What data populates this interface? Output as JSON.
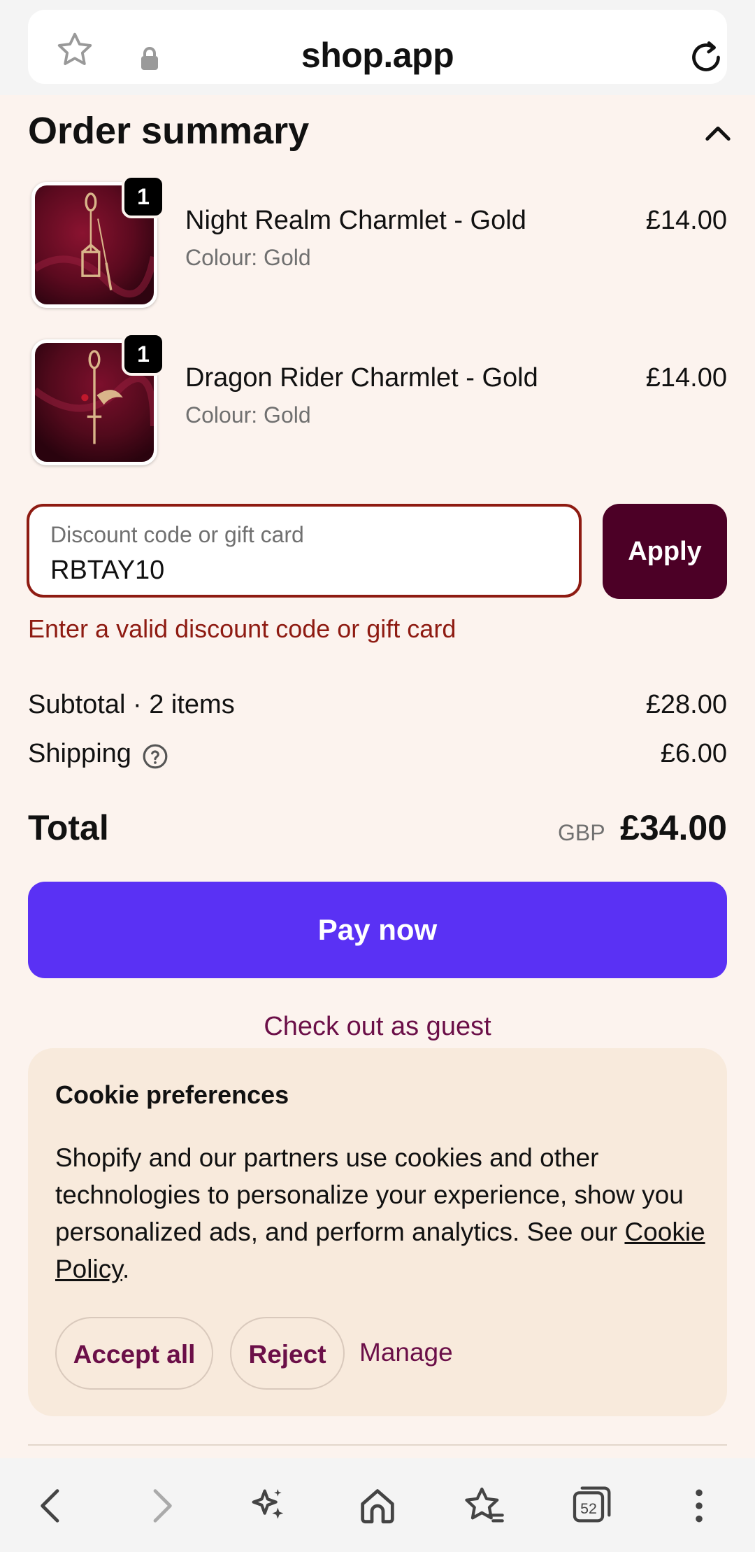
{
  "browser": {
    "domain": "shop.app",
    "tab_count": "52"
  },
  "order_summary": {
    "title": "Order summary",
    "items": [
      {
        "name": "Night Realm Charmlet - Gold",
        "variant": "Colour: Gold",
        "price": "£14.00",
        "quantity": "1"
      },
      {
        "name": "Dragon Rider Charmlet - Gold",
        "variant": "Colour: Gold",
        "price": "£14.00",
        "quantity": "1"
      }
    ]
  },
  "discount": {
    "label": "Discount code or gift card",
    "value": "RBTAY10",
    "apply_label": "Apply",
    "error": "Enter a valid discount code or gift card"
  },
  "totals": {
    "subtotal_label": "Subtotal · 2 items",
    "subtotal_value": "£28.00",
    "shipping_label": "Shipping",
    "shipping_value": "£6.00",
    "total_label": "Total",
    "currency": "GBP",
    "total_value": "£34.00"
  },
  "actions": {
    "pay_label": "Pay now",
    "guest_label": "Check out as guest"
  },
  "cookie": {
    "title": "Cookie preferences",
    "body": "Shopify and our partners use cookies and other technologies to personalize your experience, show you personalized ads, and perform analytics. See our ",
    "policy_link": "Cookie Policy",
    "body_end": ".",
    "accept_label": "Accept all",
    "reject_label": "Reject",
    "manage_label": "Manage"
  },
  "colors": {
    "page_bg": "#fcf3ee",
    "pay_button": "#5a31f4",
    "apply_button": "#4c0026",
    "error": "#8e1b12",
    "link": "#6b0f48",
    "cookie_panel": "#f8eadc"
  }
}
